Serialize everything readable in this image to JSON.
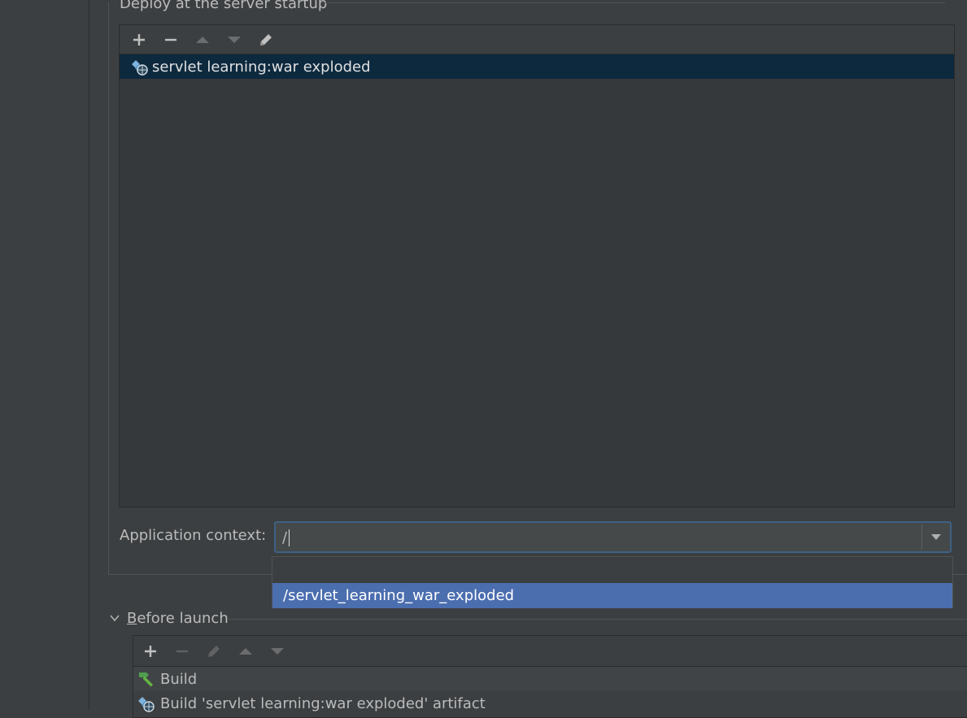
{
  "deploy_section": {
    "title": "Deploy at the server startup",
    "toolbar": [
      {
        "icon": "plus-icon",
        "enabled": true
      },
      {
        "icon": "minus-icon",
        "enabled": true
      },
      {
        "icon": "arrow-up-icon",
        "enabled": false
      },
      {
        "icon": "arrow-down-icon",
        "enabled": false
      },
      {
        "icon": "edit-pencil-icon",
        "enabled": true
      }
    ],
    "items": [
      {
        "icon": "artifact-web-icon",
        "label": "servlet learning:war exploded",
        "selected": true
      }
    ]
  },
  "application_context": {
    "label": "Application context:",
    "value": "/",
    "dropdown_options": [
      "",
      "/servlet_learning_war_exploded"
    ],
    "highlighted_option": "/servlet_learning_war_exploded"
  },
  "before_launch": {
    "title_mnemonic": "B",
    "title_rest": "efore launch",
    "expanded": true,
    "toolbar": [
      {
        "icon": "plus-icon",
        "enabled": true
      },
      {
        "icon": "minus-icon",
        "enabled": false
      },
      {
        "icon": "edit-pencil-icon",
        "enabled": false
      },
      {
        "icon": "arrow-up-icon",
        "enabled": false
      },
      {
        "icon": "arrow-down-icon",
        "enabled": false
      }
    ],
    "tasks": [
      {
        "icon": "build-hammer-icon",
        "label": "Build"
      },
      {
        "icon": "artifact-web-icon",
        "label": "Build 'servlet learning:war exploded' artifact"
      }
    ]
  },
  "colors": {
    "background": "#3c3f41",
    "selection": "#0d293e",
    "dropdown_highlight": "#4b6eaf",
    "focus_border": "#3d6185"
  }
}
